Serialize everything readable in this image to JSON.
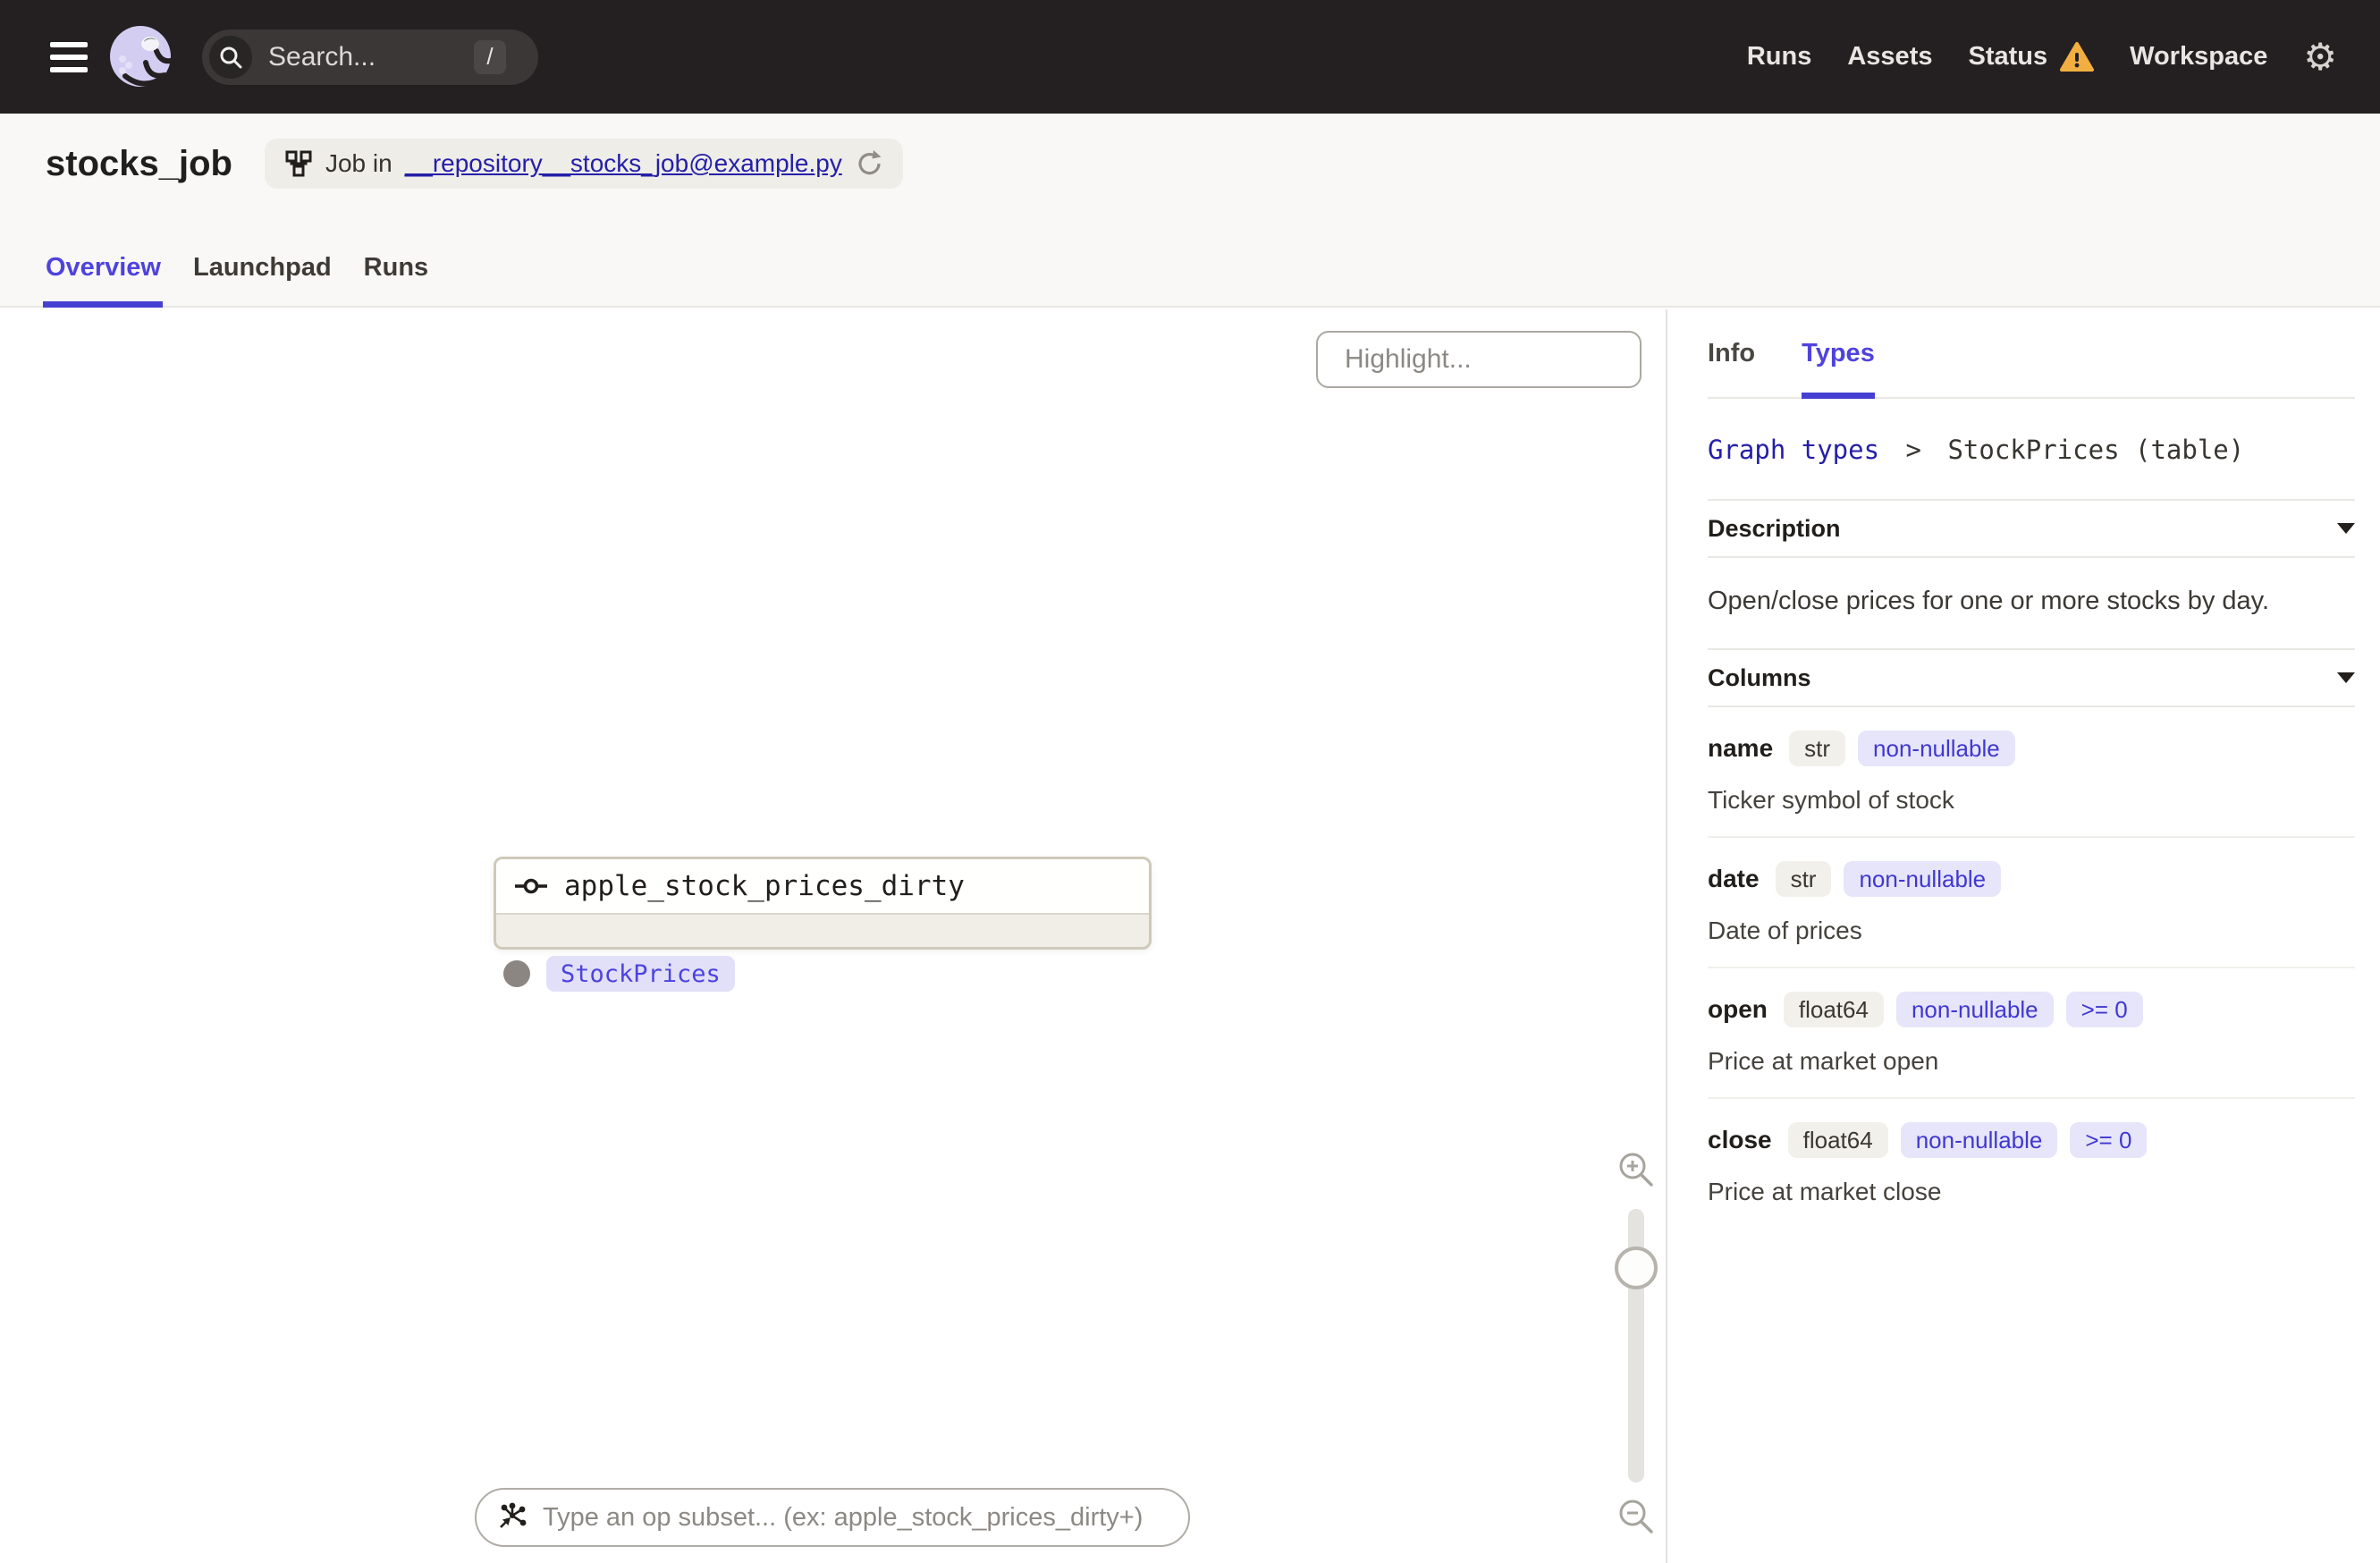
{
  "colors": {
    "accent": "#4F43DD",
    "link": "#241FA8",
    "warning": "#F2AF41"
  },
  "icons": {
    "gear": "⚙"
  },
  "topnav": {
    "search": {
      "placeholder": "Search...",
      "shortcut": "/"
    },
    "items": [
      {
        "label": "Runs"
      },
      {
        "label": "Assets"
      },
      {
        "label": "Status"
      },
      {
        "label": "Workspace"
      }
    ]
  },
  "header": {
    "title": "stocks_job",
    "job_pill": {
      "prefix": "Job in",
      "link": "__repository__stocks_job@example.py"
    },
    "tabs": [
      {
        "label": "Overview"
      },
      {
        "label": "Launchpad"
      },
      {
        "label": "Runs"
      }
    ]
  },
  "graph": {
    "highlight_placeholder": "Highlight...",
    "node": {
      "name": "apple_stock_prices_dirty",
      "output_type": "StockPrices"
    },
    "op_subset_placeholder": "Type an op subset... (ex: apple_stock_prices_dirty+)"
  },
  "sidebar": {
    "tabs": [
      {
        "label": "Info"
      },
      {
        "label": "Types"
      }
    ],
    "breadcrumb": {
      "link": "Graph types",
      "separator": ">",
      "current": "StockPrices (table)"
    },
    "description": {
      "title": "Description",
      "body": "Open/close prices for one or more stocks by day."
    },
    "columns": {
      "title": "Columns",
      "rows": [
        {
          "name": "name",
          "type": "str",
          "constraints": [
            "non-nullable"
          ],
          "description": "Ticker symbol of stock"
        },
        {
          "name": "date",
          "type": "str",
          "constraints": [
            "non-nullable"
          ],
          "description": "Date of prices"
        },
        {
          "name": "open",
          "type": "float64",
          "constraints": [
            "non-nullable",
            ">= 0"
          ],
          "description": "Price at market open"
        },
        {
          "name": "close",
          "type": "float64",
          "constraints": [
            "non-nullable",
            ">= 0"
          ],
          "description": "Price at market close"
        }
      ]
    }
  }
}
